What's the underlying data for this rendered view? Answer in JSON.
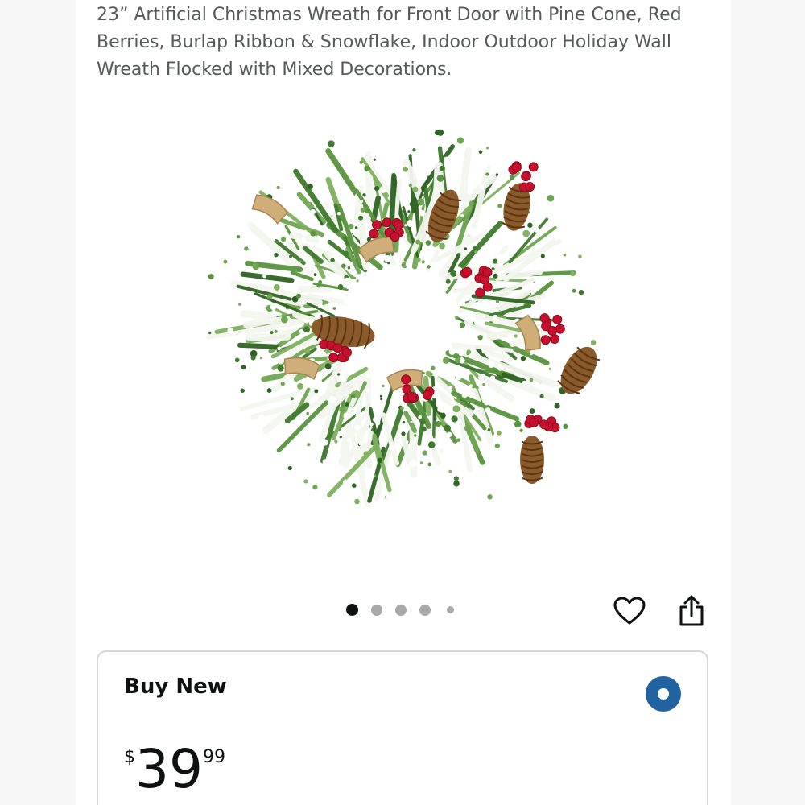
{
  "product": {
    "title": "23” Artificial Christmas Wreath for Front Door with Pine Cone, Red Berries, Burlap Ribbon & Snowflake, Indoor Outdoor Holiday Wall Wreath Flocked with Mixed Decorations.",
    "image_alt": "Snow-flocked pine wreath with pine cones, red berries and burlap ribbon"
  },
  "carousel": {
    "total": 5,
    "active_index": 0
  },
  "actions": {
    "wishlist_icon": "heart-icon",
    "share_icon": "share-icon"
  },
  "buy_box": {
    "label": "Buy New",
    "selected": true,
    "price": {
      "symbol": "$",
      "whole": "39",
      "fraction": "99"
    }
  },
  "colors": {
    "title_text": "#565959",
    "radio_selected": "#2162a1",
    "dot_active": "#0f1111",
    "dot_inactive": "#a9a9a9",
    "card_border": "#d5d9d9"
  }
}
